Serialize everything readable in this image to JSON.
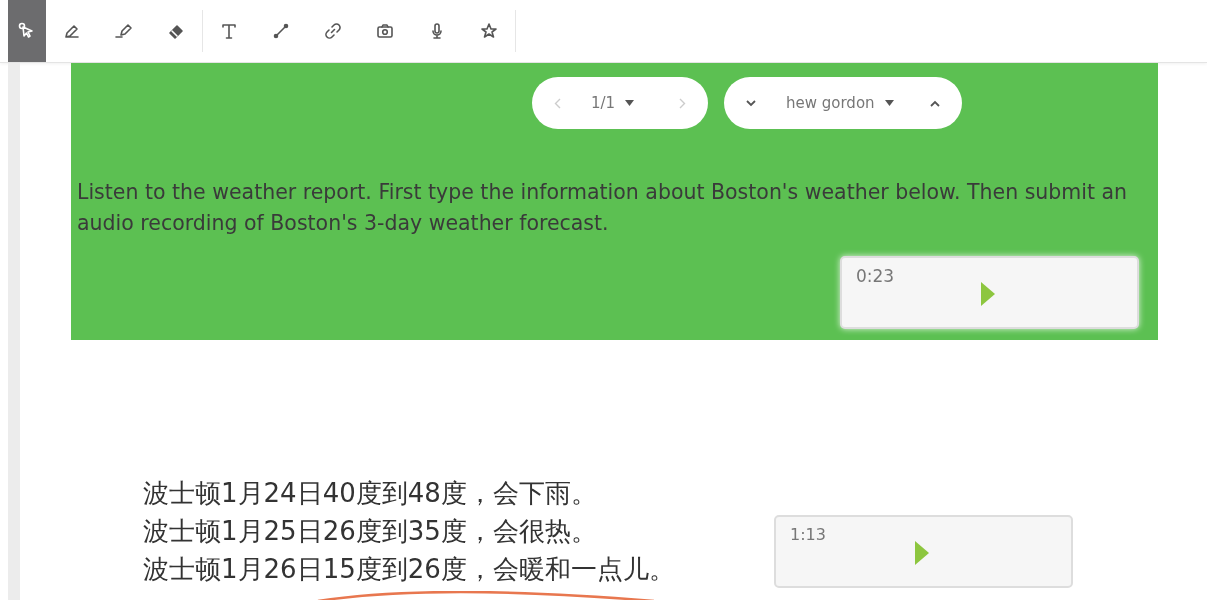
{
  "toolbar": {
    "groups": [
      [
        {
          "kind": "select",
          "selected": true
        },
        {
          "kind": "pen",
          "selected": false
        },
        {
          "kind": "highlighter",
          "selected": false
        },
        {
          "kind": "eraser",
          "selected": false
        }
      ],
      [
        {
          "kind": "text",
          "selected": false
        },
        {
          "kind": "line",
          "selected": false
        },
        {
          "kind": "link",
          "selected": false
        },
        {
          "kind": "camera",
          "selected": false
        },
        {
          "kind": "mic",
          "selected": false
        },
        {
          "kind": "star",
          "selected": false
        }
      ]
    ]
  },
  "page_nav": {
    "label": "1/1"
  },
  "student_nav": {
    "label": "hew gordon"
  },
  "prompt": {
    "text": "Listen to the weather report. First type the information about Boston's weather below. Then submit an audio recording of Boston's 3-day weather forecast.",
    "audio": {
      "time": "0:23"
    }
  },
  "answer": {
    "lines": [
      "波士顿1月24日40度到48度，会下雨。",
      "波士顿1月25日26度到35度，会很热。",
      "波士顿1月26日15度到26度，会暖和一点儿。"
    ],
    "audio": {
      "time": "1:13"
    }
  }
}
